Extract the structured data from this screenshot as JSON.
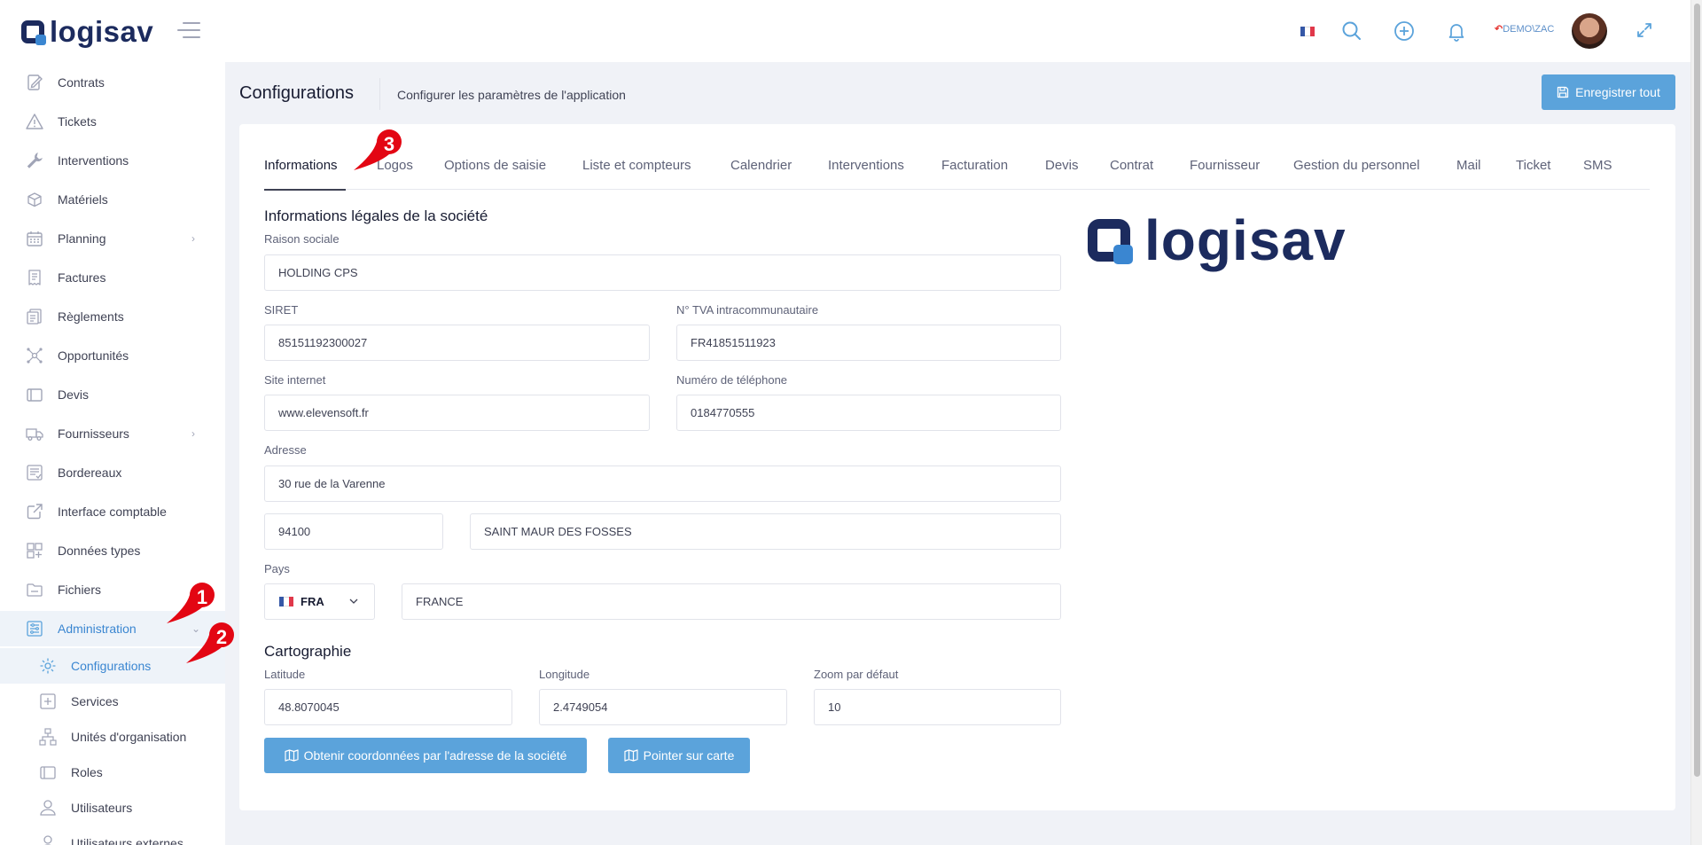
{
  "header": {
    "logo_text": "logisav",
    "user_label": "DEMO\\ZAC"
  },
  "sidebar": {
    "items": [
      {
        "label": "Contrats",
        "icon": "contract-icon"
      },
      {
        "label": "Tickets",
        "icon": "warning-icon"
      },
      {
        "label": "Interventions",
        "icon": "wrench-icon"
      },
      {
        "label": "Matériels",
        "icon": "box-icon"
      },
      {
        "label": "Planning",
        "icon": "calendar-icon"
      },
      {
        "label": "Factures",
        "icon": "invoice-icon"
      },
      {
        "label": "Règlements",
        "icon": "payment-icon"
      },
      {
        "label": "Opportunités",
        "icon": "opportunity-icon"
      },
      {
        "label": "Devis",
        "icon": "quote-icon"
      },
      {
        "label": "Fournisseurs",
        "icon": "truck-icon"
      },
      {
        "label": "Bordereaux",
        "icon": "slip-icon"
      },
      {
        "label": "Interface comptable",
        "icon": "external-link-icon"
      },
      {
        "label": "Données types",
        "icon": "grid-icon"
      },
      {
        "label": "Fichiers",
        "icon": "folder-icon"
      },
      {
        "label": "Administration",
        "icon": "admin-icon"
      }
    ],
    "subitems": [
      {
        "label": "Configurations",
        "icon": "gear-icon"
      },
      {
        "label": "Services",
        "icon": "services-icon"
      },
      {
        "label": "Unités d'organisation",
        "icon": "org-icon"
      },
      {
        "label": "Roles",
        "icon": "roles-icon"
      },
      {
        "label": "Utilisateurs",
        "icon": "user-icon"
      },
      {
        "label": "Utilisateurs externes",
        "icon": "external-user-icon"
      }
    ]
  },
  "page": {
    "title": "Configurations",
    "subtitle": "Configurer les paramètres de l'application",
    "save_all_label": "Enregistrer tout"
  },
  "tabs": [
    "Informations",
    "Logos",
    "Options de saisie",
    "Liste et compteurs",
    "Calendrier",
    "Interventions",
    "Facturation",
    "Devis",
    "Contrat",
    "Fournisseur",
    "Gestion du personnel",
    "Mail",
    "Ticket",
    "SMS"
  ],
  "form": {
    "section_legal": "Informations légales de la société",
    "raison_sociale_label": "Raison sociale",
    "raison_sociale": "HOLDING CPS",
    "siret_label": "SIRET",
    "siret": "85151192300027",
    "tva_label": "N° TVA intracommunautaire",
    "tva": "FR41851511923",
    "site_label": "Site internet",
    "site": "www.elevensoft.fr",
    "phone_label": "Numéro de téléphone",
    "phone": "0184770555",
    "adresse_label": "Adresse",
    "adresse": "30 rue de la Varenne",
    "cp": "94100",
    "ville": "SAINT MAUR DES FOSSES",
    "pays_label": "Pays",
    "pays_code": "FRA",
    "pays_name": "FRANCE",
    "section_carto": "Cartographie",
    "lat_label": "Latitude",
    "lat": "48.8070045",
    "lon_label": "Longitude",
    "lon": "2.4749054",
    "zoom_label": "Zoom par défaut",
    "zoom": "10",
    "btn_coords": "Obtenir coordonnées par l'adresse de la société",
    "btn_map": "Pointer sur carte"
  },
  "annotations": [
    "1",
    "2",
    "3"
  ],
  "colors": {
    "primary": "#5ba3db",
    "brand": "#1c2b5e",
    "badge": "#e30613"
  }
}
